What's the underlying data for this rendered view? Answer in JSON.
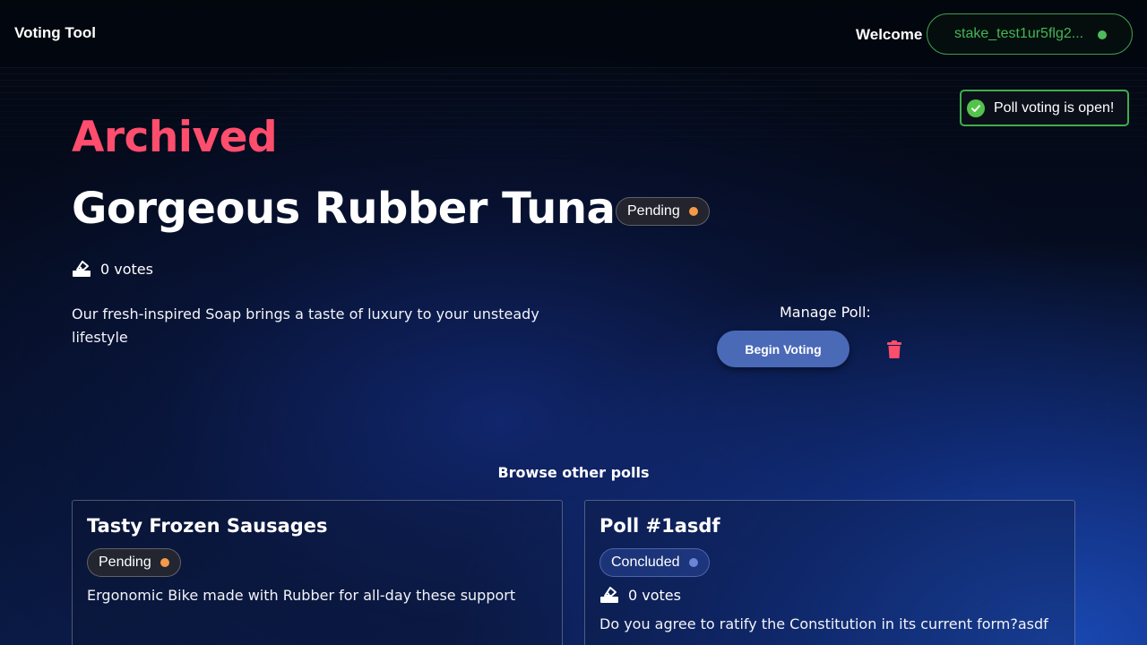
{
  "header": {
    "brand": "Voting Tool",
    "welcome": "Welcome",
    "wallet_address": "stake_test1ur5flg2...",
    "wallet_status_color": "#4dbb5e"
  },
  "toast": {
    "message": "Poll voting is open!",
    "icon": "check-circle-icon"
  },
  "poll": {
    "archived_label": "Archived",
    "title": "Gorgeous Rubber Tuna",
    "status": "Pending",
    "votes": "0 votes",
    "vote_icon": "ballot-box-icon",
    "description": "Our fresh-inspired Soap brings a taste of luxury to your unsteady lifestyle",
    "manage_label": "Manage Poll:",
    "begin_voting_label": "Begin Voting",
    "delete_icon": "trash-icon"
  },
  "browse": {
    "heading": "Browse other polls",
    "polls": [
      {
        "title": "Tasty Frozen Sausages",
        "status": "Pending",
        "description": "Ergonomic Bike made with Rubber for all-day these support"
      },
      {
        "title": "Poll #1asdf",
        "status": "Concluded",
        "votes": "0 votes",
        "description": "Do you agree to ratify the Constitution in its current form?asdf"
      }
    ]
  },
  "colors": {
    "accent_red": "#ff4d6d",
    "success_green": "#3fae4c",
    "pending_dot": "#f59a4a",
    "concluded_dot": "#6b86d6",
    "primary_button": "#4a6ab8"
  }
}
